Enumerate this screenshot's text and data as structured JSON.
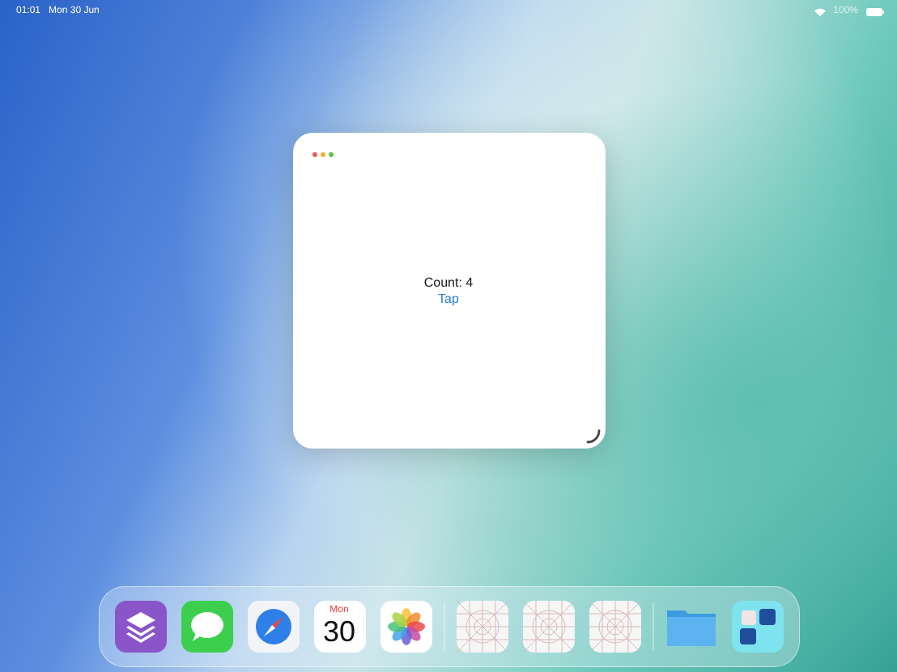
{
  "status_bar": {
    "time": "01:01",
    "date": "Mon 30 Jun",
    "battery": "100%"
  },
  "window": {
    "count_label": "Count: 4",
    "button": "Tap"
  },
  "dock": {
    "groups": [
      [
        {
          "kind": "layers"
        },
        {
          "kind": "messages"
        },
        {
          "kind": "compass"
        },
        {
          "kind": "calendar",
          "weekday": "Mon",
          "day": "30"
        },
        {
          "kind": "photos"
        }
      ],
      [
        {
          "kind": "grid"
        },
        {
          "kind": "grid"
        },
        {
          "kind": "grid"
        }
      ],
      [
        {
          "kind": "folder"
        },
        {
          "kind": "widgets"
        }
      ]
    ]
  }
}
